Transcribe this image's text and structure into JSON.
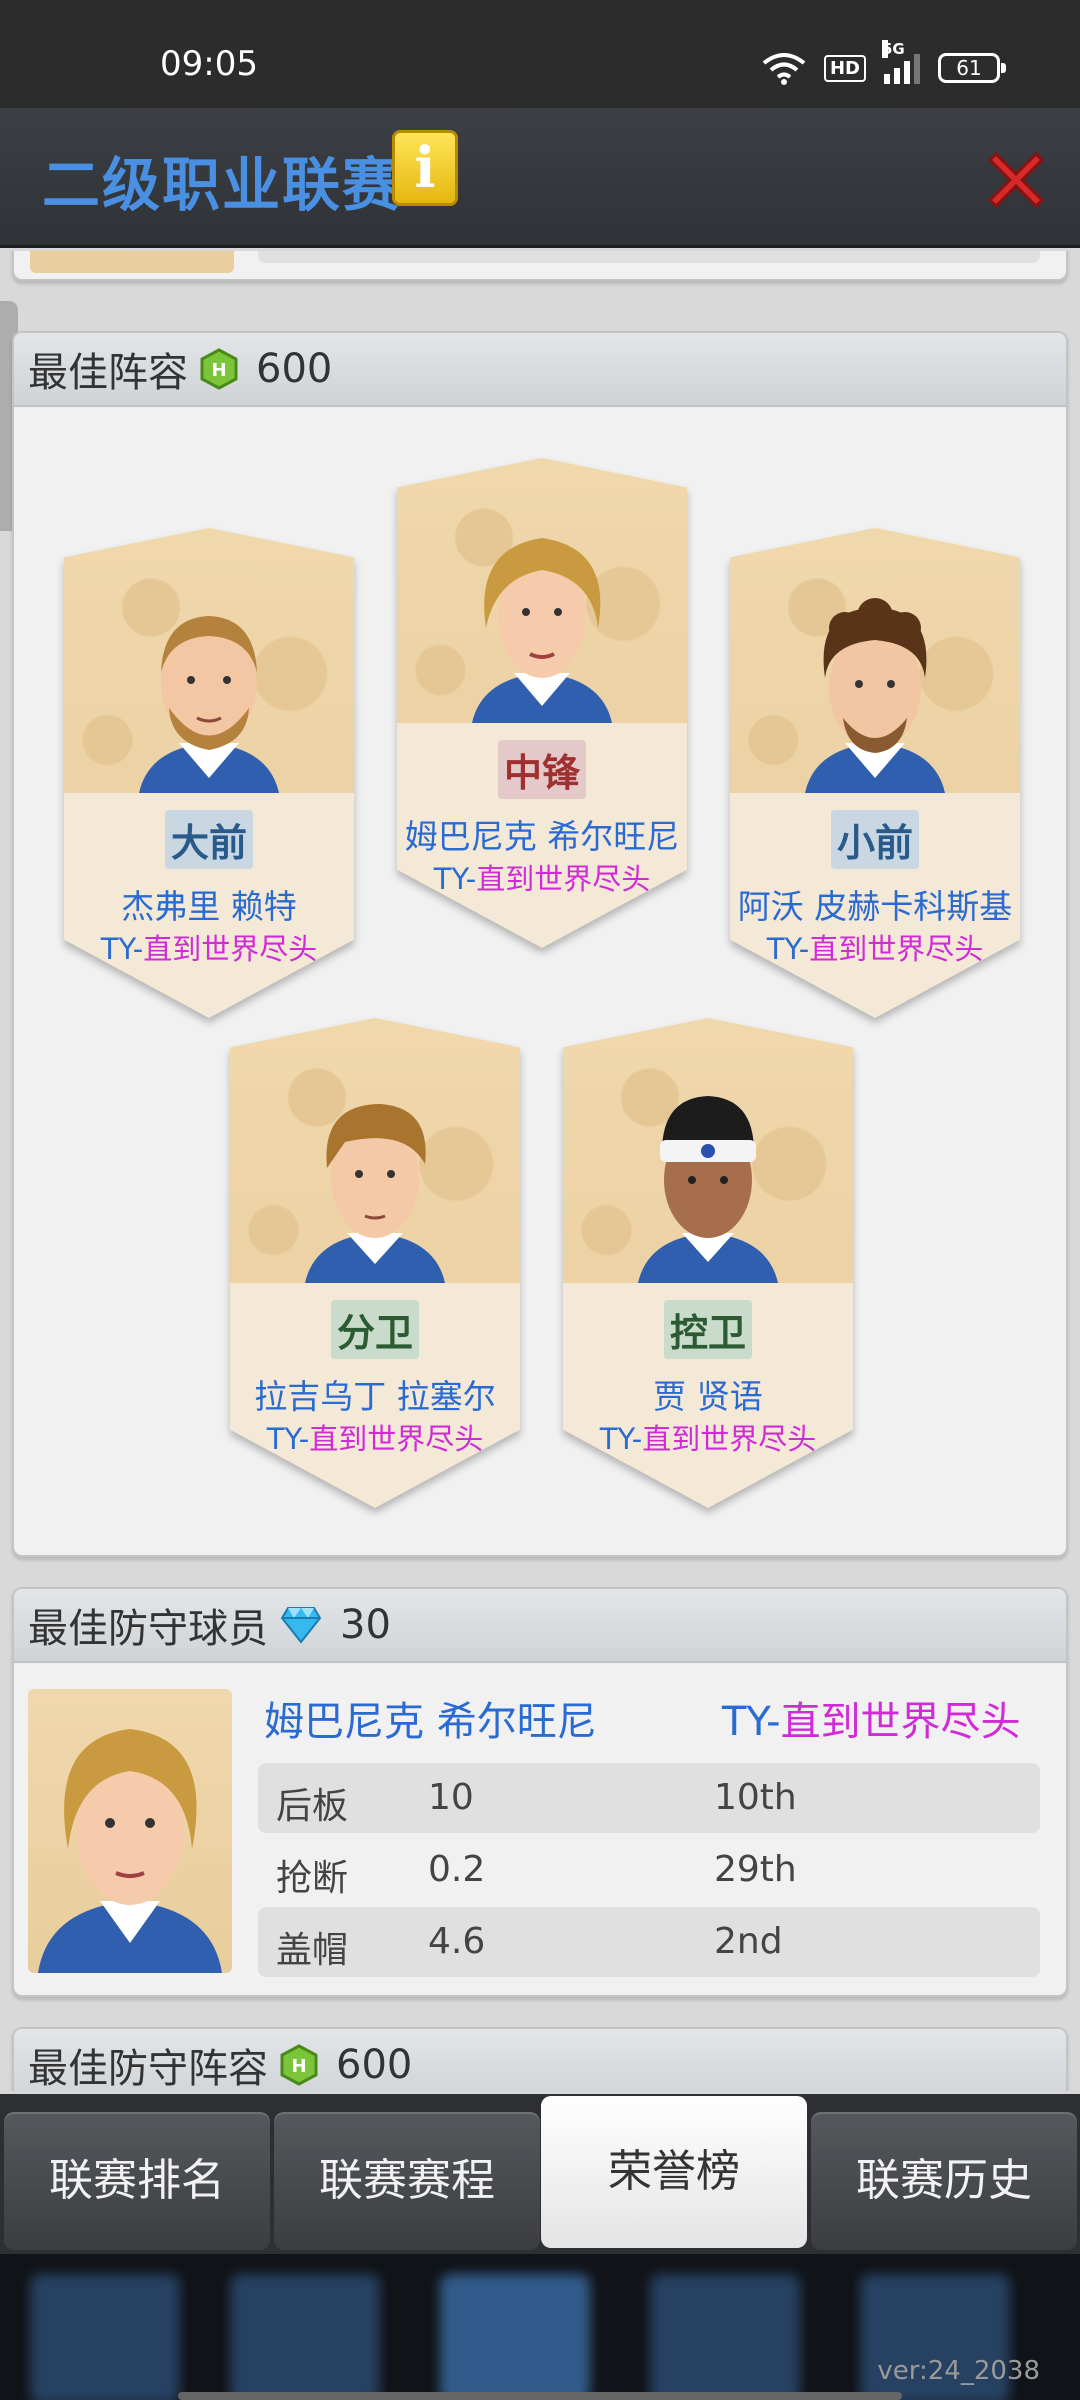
{
  "status_bar": {
    "time": "09:05",
    "battery": "61",
    "network": "5G",
    "hd": "HD"
  },
  "header": {
    "title": "二级职业联赛",
    "info_icon": "i"
  },
  "best_lineup": {
    "title": "最佳阵容",
    "reward_icon": "hex-coin-icon",
    "reward_value": "600",
    "players": [
      {
        "position": "大前",
        "name": "杰弗里 赖特",
        "team_prefix": "TY-",
        "team_name": "直到世界尽头"
      },
      {
        "position": "中锋",
        "name": "姆巴尼克 希尔旺尼",
        "team_prefix": "TY-",
        "team_name": "直到世界尽头"
      },
      {
        "position": "小前",
        "name": "阿沃 皮赫卡科斯基",
        "team_prefix": "TY-",
        "team_name": "直到世界尽头"
      },
      {
        "position": "分卫",
        "name": "拉吉乌丁 拉塞尔",
        "team_prefix": "TY-",
        "team_name": "直到世界尽头"
      },
      {
        "position": "控卫",
        "name": "贾 贤语",
        "team_prefix": "TY-",
        "team_name": "直到世界尽头"
      }
    ]
  },
  "best_defender": {
    "title": "最佳防守球员",
    "reward_icon": "gem-icon",
    "reward_value": "30",
    "name": "姆巴尼克 希尔旺尼",
    "team_prefix": "TY-",
    "team_name": "直到世界尽头",
    "stats": [
      {
        "label": "后板",
        "value": "10",
        "rank": "10th"
      },
      {
        "label": "抢断",
        "value": "0.2",
        "rank": "29th"
      },
      {
        "label": "盖帽",
        "value": "4.6",
        "rank": "2nd"
      }
    ]
  },
  "best_defensive_lineup": {
    "title": "最佳防守阵容",
    "reward_icon": "hex-coin-icon",
    "reward_value": "600"
  },
  "tabs": [
    {
      "label": "联赛排名",
      "active": false
    },
    {
      "label": "联赛赛程",
      "active": false
    },
    {
      "label": "荣誉榜",
      "active": true
    },
    {
      "label": "联赛历史",
      "active": false
    }
  ],
  "version": "ver:24_2038",
  "colors": {
    "title_blue": "#4a90e2",
    "name_blue": "#2a6bd1",
    "team_magenta": "#d12ad7",
    "close_red": "#d42a2a"
  }
}
